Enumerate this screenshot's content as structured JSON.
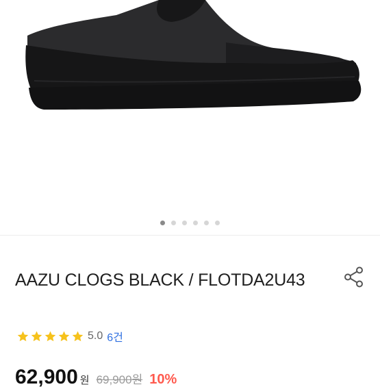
{
  "gallery": {
    "image_alt": "Black clog shoe",
    "slide_count": 6,
    "active_index": 0
  },
  "product": {
    "title": "AAZU CLOGS BLACK / FLOTDA2U43",
    "rating": {
      "stars": 5,
      "score": "5.0",
      "review_count": "6건"
    },
    "price": {
      "current": "62,900",
      "current_unit": "원",
      "original": "69,900원",
      "discount": "10%"
    }
  },
  "icons": {
    "share": "share-icon",
    "star": "star-icon"
  },
  "colors": {
    "star": "#f6c21c",
    "review_link": "#2e6fe0",
    "discount": "#ff5a4e"
  }
}
